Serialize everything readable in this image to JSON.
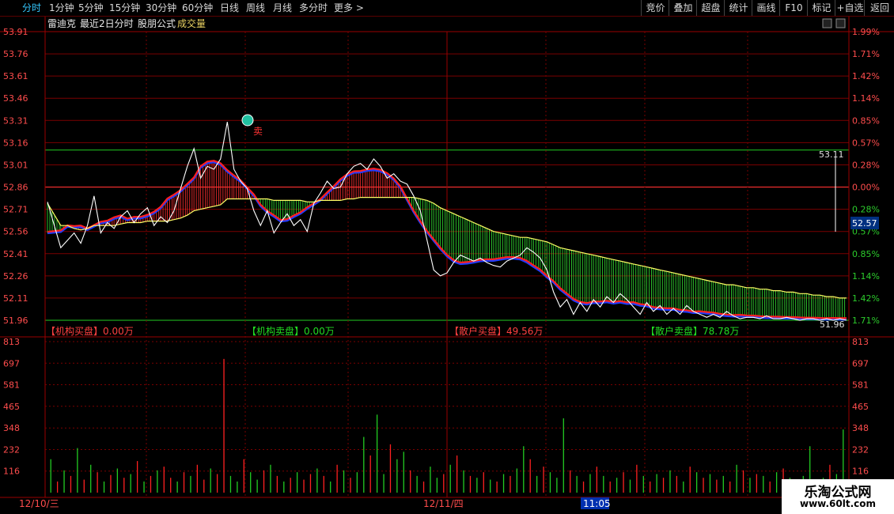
{
  "toolbar": {
    "tabs": [
      "分时",
      "1分钟",
      "5分钟",
      "15分钟",
      "30分钟",
      "60分钟",
      "日线",
      "周线",
      "月线",
      "多分时",
      "更多 >"
    ],
    "active_tab": "分时",
    "right_buttons": [
      "竞价",
      "叠加",
      "超盘",
      "统计",
      "画线",
      "F10",
      "标记",
      "+自选",
      "返回"
    ]
  },
  "header": {
    "stock_name": "雷迪克",
    "mode": "最近2日分时",
    "formula": "股朋公式",
    "indicator": "成交量"
  },
  "colors": {
    "grid_red": "#7a0000",
    "price_line": "#ffffff",
    "avg_line": "#ffff66",
    "up_red": "#ff2020",
    "down_green": "#22cc22",
    "value_red": "#ff4040",
    "value_green": "#22dd22",
    "tick_label": "#ff4d4d",
    "date_label": "#ff4d4d"
  },
  "chart_data": [
    {
      "type": "line",
      "name": "price",
      "y_ticks_left": [
        "53.91",
        "53.76",
        "53.61",
        "53.46",
        "53.31",
        "53.16",
        "53.01",
        "52.86",
        "52.71",
        "52.56",
        "52.41",
        "52.26",
        "52.11",
        "51.96"
      ],
      "y_ticks_right": [
        "1.99%",
        "1.71%",
        "1.42%",
        "1.14%",
        "0.85%",
        "0.57%",
        "0.28%",
        "0.00%",
        "0.28%",
        "0.57%",
        "0.85%",
        "1.14%",
        "1.42%",
        "1.71%"
      ],
      "ylim": [
        51.96,
        53.91
      ],
      "reference_price": 52.86,
      "price_high_label": "53.11",
      "current_price_label": "52.57",
      "price_low_label": "51.96",
      "sell_signal": "卖",
      "x": [
        0,
        4,
        6,
        8,
        10,
        12,
        14,
        16,
        18,
        20,
        22,
        24,
        26,
        28,
        30,
        32,
        34,
        36,
        38,
        40,
        42,
        44,
        46,
        48,
        50,
        52,
        54,
        56,
        58,
        60,
        62,
        64,
        66,
        68,
        70,
        72,
        74,
        76,
        78,
        80,
        82,
        84,
        86,
        88,
        90,
        92,
        94,
        96,
        98,
        100,
        102,
        104,
        106,
        108,
        110,
        112,
        114,
        116,
        118,
        120,
        122,
        124,
        126,
        128,
        130,
        132,
        134,
        136,
        138,
        140,
        142,
        144,
        146,
        148,
        150,
        152,
        154,
        156,
        158,
        160,
        162,
        164,
        166,
        168,
        170,
        172,
        174,
        176,
        178,
        180,
        182,
        184,
        186,
        188,
        190,
        192,
        194,
        196,
        198,
        200,
        202,
        204,
        206,
        208,
        210,
        212,
        214,
        216,
        218,
        220,
        222,
        224,
        226,
        228,
        230,
        232,
        234,
        236,
        238,
        240
      ],
      "price": [
        52.76,
        52.45,
        52.5,
        52.55,
        52.48,
        52.6,
        52.8,
        52.55,
        52.62,
        52.58,
        52.66,
        52.7,
        52.62,
        52.68,
        52.72,
        52.6,
        52.66,
        52.62,
        52.7,
        52.85,
        53.0,
        53.12,
        52.92,
        53.0,
        52.98,
        53.05,
        53.3,
        52.98,
        52.9,
        52.85,
        52.7,
        52.6,
        52.7,
        52.55,
        52.62,
        52.68,
        52.6,
        52.64,
        52.56,
        52.75,
        52.82,
        52.9,
        52.85,
        52.86,
        52.95,
        53.0,
        53.02,
        52.98,
        53.05,
        53.0,
        52.92,
        52.95,
        52.9,
        52.88,
        52.8,
        52.7,
        52.5,
        52.3,
        52.26,
        52.28,
        52.35,
        52.4,
        52.38,
        52.36,
        52.38,
        52.35,
        52.33,
        52.32,
        52.36,
        52.38,
        52.4,
        52.45,
        52.42,
        52.38,
        52.3,
        52.15,
        52.05,
        52.1,
        52.0,
        52.08,
        52.02,
        52.1,
        52.05,
        52.12,
        52.08,
        52.14,
        52.1,
        52.05,
        52.0,
        52.08,
        52.02,
        52.06,
        52.0,
        52.04,
        52.0,
        52.06,
        52.02,
        52.0,
        51.98,
        52.0,
        51.98,
        52.02,
        51.99,
        51.97,
        51.98,
        51.98,
        51.97,
        51.99,
        51.97,
        51.97,
        51.98,
        51.97,
        51.96,
        51.97,
        51.97,
        51.96,
        51.97,
        51.96,
        51.97,
        51.96
      ],
      "avg": [
        52.75,
        52.6,
        52.6,
        52.58,
        52.57,
        52.58,
        52.6,
        52.6,
        52.6,
        52.6,
        52.61,
        52.62,
        52.62,
        52.62,
        52.63,
        52.63,
        52.63,
        52.63,
        52.64,
        52.65,
        52.67,
        52.7,
        52.71,
        52.72,
        52.73,
        52.74,
        52.78,
        52.78,
        52.78,
        52.78,
        52.78,
        52.78,
        52.78,
        52.77,
        52.77,
        52.77,
        52.77,
        52.77,
        52.76,
        52.76,
        52.77,
        52.77,
        52.77,
        52.77,
        52.78,
        52.78,
        52.79,
        52.79,
        52.79,
        52.79,
        52.79,
        52.79,
        52.79,
        52.79,
        52.79,
        52.78,
        52.77,
        52.75,
        52.72,
        52.7,
        52.68,
        52.66,
        52.64,
        52.62,
        52.6,
        52.58,
        52.56,
        52.55,
        52.54,
        52.53,
        52.52,
        52.52,
        52.51,
        52.5,
        52.49,
        52.47,
        52.45,
        52.44,
        52.43,
        52.42,
        52.41,
        52.4,
        52.39,
        52.38,
        52.37,
        52.36,
        52.35,
        52.34,
        52.33,
        52.32,
        52.31,
        52.3,
        52.29,
        52.28,
        52.27,
        52.26,
        52.25,
        52.24,
        52.23,
        52.22,
        52.21,
        52.2,
        52.2,
        52.19,
        52.18,
        52.18,
        52.17,
        52.17,
        52.16,
        52.16,
        52.15,
        52.15,
        52.14,
        52.14,
        52.13,
        52.13,
        52.12,
        52.12,
        52.11,
        52.11
      ]
    },
    {
      "type": "bar",
      "name": "volume",
      "y_ticks": [
        "813",
        "697",
        "581",
        "465",
        "348",
        "232",
        "116"
      ],
      "ylim": [
        0,
        813
      ],
      "x_labels": [
        "12/10/三",
        "12/11/四",
        "11:05"
      ],
      "values_up_down_note": "",
      "values": [
        180,
        60,
        120,
        90,
        240,
        70,
        150,
        110,
        60,
        95,
        130,
        80,
        100,
        170,
        60,
        90,
        120,
        140,
        80,
        60,
        110,
        90,
        150,
        70,
        130,
        100,
        720,
        90,
        60,
        180,
        110,
        70,
        120,
        150,
        90,
        60,
        80,
        110,
        70,
        100,
        130,
        90,
        60,
        150,
        120,
        80,
        110,
        300,
        200,
        420,
        100,
        260,
        180,
        220,
        120,
        90,
        60,
        140,
        80,
        100,
        150,
        200,
        120,
        90,
        80,
        110,
        70,
        60,
        100,
        90,
        130,
        250,
        180,
        90,
        140,
        110,
        80,
        400,
        120,
        90,
        60,
        100,
        140,
        90,
        60,
        80,
        110,
        70,
        150,
        90,
        60,
        100,
        80,
        120,
        90,
        60,
        140,
        110,
        80,
        100,
        70,
        90,
        60,
        150,
        120,
        80,
        100,
        90,
        60,
        110,
        130,
        80,
        70,
        90,
        250,
        60,
        80,
        150,
        100,
        340
      ],
      "colors": [
        "d",
        "u",
        "d",
        "u",
        "d",
        "u",
        "d",
        "u",
        "d",
        "u",
        "d",
        "u",
        "d",
        "u",
        "d",
        "u",
        "d",
        "u",
        "u",
        "d",
        "u",
        "d",
        "u",
        "u",
        "d",
        "u",
        "u",
        "d",
        "d",
        "u",
        "d",
        "d",
        "u",
        "d",
        "u",
        "d",
        "u",
        "d",
        "u",
        "u",
        "d",
        "u",
        "d",
        "u",
        "d",
        "u",
        "d",
        "d",
        "u",
        "d",
        "d",
        "u",
        "d",
        "d",
        "u",
        "d",
        "u",
        "d",
        "d",
        "u",
        "d",
        "u",
        "d",
        "u",
        "d",
        "u",
        "d",
        "u",
        "d",
        "u",
        "d",
        "d",
        "u",
        "d",
        "u",
        "d",
        "d",
        "d",
        "u",
        "d",
        "u",
        "d",
        "u",
        "d",
        "u",
        "d",
        "u",
        "d",
        "u",
        "d",
        "u",
        "d",
        "u",
        "d",
        "u",
        "d",
        "u",
        "d",
        "u",
        "d",
        "u",
        "d",
        "u",
        "d",
        "u",
        "d",
        "u",
        "d",
        "u",
        "d",
        "u",
        "d",
        "u",
        "d",
        "d",
        "u",
        "d",
        "u",
        "d",
        "d"
      ]
    }
  ],
  "flows": [
    {
      "label": "【机构买盘】",
      "value": "0.00万",
      "color": "up"
    },
    {
      "label": "【机构卖盘】",
      "value": "0.00万",
      "color": "down"
    },
    {
      "label": "【散户买盘】",
      "value": "49.56万",
      "color": "up"
    },
    {
      "label": "【散户卖盘】",
      "value": "78.78万",
      "color": "down"
    }
  ],
  "watermark": {
    "title": "乐淘公式网",
    "url": "www.60lt.com"
  }
}
